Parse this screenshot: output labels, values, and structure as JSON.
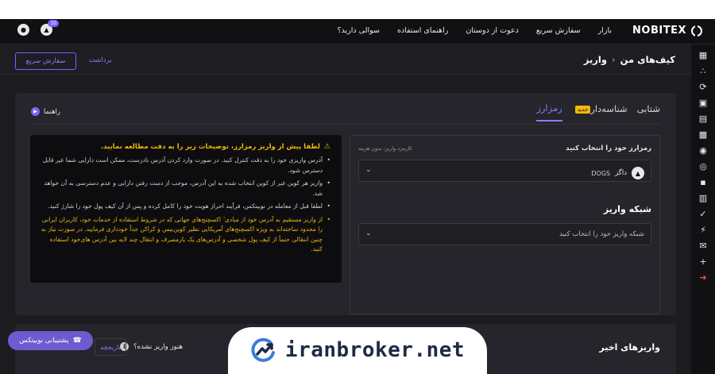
{
  "topnav": {
    "brand": "NOBITEX",
    "links": [
      "بازار",
      "سفارش سریع",
      "دعوت از دوستان",
      "راهنمای استفاده",
      "سوالی دارید؟"
    ],
    "notification_count": "10"
  },
  "breadcrumb": {
    "parent": "کیف‌های من",
    "separator": "›",
    "current": "واریز"
  },
  "actions": {
    "quick_order": "سفارش سریع",
    "withdraw": "برداشت"
  },
  "tabs": [
    {
      "label": "شتابی"
    },
    {
      "label": "شناسه‌دار",
      "badge": "جدید"
    },
    {
      "label": "رمزارز"
    }
  ],
  "guide": {
    "label": "راهنما"
  },
  "warning": {
    "title": "لطفا پیش از واریز رمزارز، توضیحات زیر را به دقت مطالعه نمایید.",
    "items": [
      "آدرس واریزی خود را به دقت کنترل کنید. در صورت وارد کردن آدرس نادرست، ممکن است دارایی شما غیر قابل دسترس شود.",
      "واریز هر کوین غیر از کوین انتخاب شده به این آدرس، موجب از دست رفتن دارایی و عدم دسترسی به آن خواهد شد.",
      "لطفا قبل از معامله در نوبیتکس، فرآیند احراز هویت خود را کامل کرده و پس از آن کیف پول خود را شارژ کنید."
    ],
    "yellow_item": "از واریز مستقیم به آدرس خود از مبادی ٔ اکسچنج‌های جهانی که در شروط استفاده از خدمات خود، کاربران ایرانی را محدود ساخته‌اند به ویژه اکسچنج‌های آمریکایی نظیر کوین‌بیس و کراکن جداً خودداری فرمایید. در صورت نیاز به چنین انتقالی حتماً از کیف پول شخصی و آدرس‌های یک بارمصرف و انتقال چند لایه بین آدرس های‌خود استفاده کنید."
  },
  "form": {
    "coin_label": "رمزارز خود را انتخاب کنید",
    "fee_note": "کارمزد واریز: بدون هزینه",
    "coin_name": "داگز",
    "coin_symbol": "DOGS",
    "network_title": "شبکه واریز",
    "network_placeholder": "شبکه واریز خود را انتخاب کنید"
  },
  "recent": {
    "title": "واریزهای اخیر",
    "not_arrived": "هنوز واریز نشده؟",
    "history_btn": "تاریخچه"
  },
  "support": {
    "label": "پشتیبانی نوبیتکس"
  },
  "watermark": {
    "text": "iranbroker.net"
  },
  "colors": {
    "accent": "#7b61ff",
    "warning": "#f0b90b",
    "bg": "#1b1b20",
    "card": "#25252b",
    "danger": "#ef4d4d"
  }
}
